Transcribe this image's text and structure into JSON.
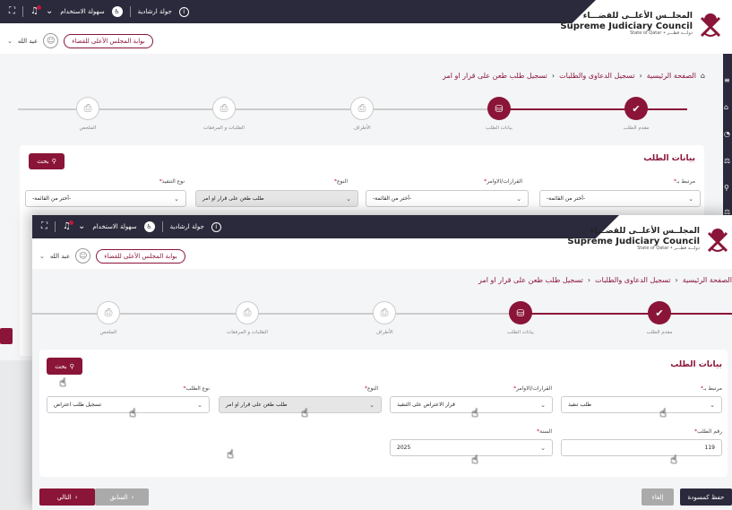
{
  "header": {
    "guide_tour": "جولة ارشادية",
    "accessibility": "سهولة الاستخدام",
    "council_ar": "المجلــس الأعلــى للقضـــاء",
    "council_en": "Supreme Judiciary Council",
    "council_sub": "State of Qatar • دولـــة قطـــر",
    "user_name": "عبد الله",
    "portal_button": "بوابة المجلس الأعلى للقضاء"
  },
  "breadcrumb": {
    "home": "الصفحة الرئيسية",
    "parent": "تسجيل الدعاوى والطلبات",
    "current": "تسجيل طلب طعن على قرار او امر",
    "separator": "‹"
  },
  "steps": [
    {
      "label": "مقدم الطلب",
      "state": "done",
      "icon": "✔"
    },
    {
      "label": "بيانات الطلب",
      "state": "active",
      "icon": "⛁"
    },
    {
      "label": "الأطراف",
      "state": "todo",
      "icon": "⎙"
    },
    {
      "label": "الطلبات و المرفقات",
      "state": "todo",
      "icon": "⎙"
    },
    {
      "label": "الملخص",
      "state": "todo",
      "icon": "⎙"
    }
  ],
  "back_form": {
    "title": "بيانات الطلب",
    "search": "بحث",
    "fields": [
      {
        "label": "مرتبط بـ",
        "value": "-أختر من القائمة-"
      },
      {
        "label": "القرارات/الاوامر",
        "value": "-أختر من القائمة-"
      },
      {
        "label": "النوع",
        "value": "طلب طعن على قرار او امر"
      },
      {
        "label": "نوع التنفيذ",
        "value": "-أختر من القائمة-"
      }
    ]
  },
  "front_form": {
    "title": "بيانات الطلب",
    "search": "بحث",
    "fields": [
      {
        "label": "مرتبط بـ",
        "value": "طلب تنفيذ"
      },
      {
        "label": "القرارات/الاوامر",
        "value": "قرار الاعتراض على التنفيذ"
      },
      {
        "label": "النوع",
        "value": "طلب طعن على قرار او امر"
      },
      {
        "label": "نوع الطلب",
        "value": "تسجيل طلب اعتراض"
      },
      {
        "label": "رقم الطلب",
        "value": "119"
      },
      {
        "label": "السنة",
        "value": "2025"
      }
    ]
  },
  "footer": {
    "save_draft": "حفظ كمسودة",
    "cancel": "إلغاء",
    "previous": "السابق",
    "next": "التالي",
    "prev_arrow": "‹",
    "next_arrow": "›"
  },
  "colors": {
    "brand": "#8a1538",
    "dark": "#2a2a3c"
  }
}
